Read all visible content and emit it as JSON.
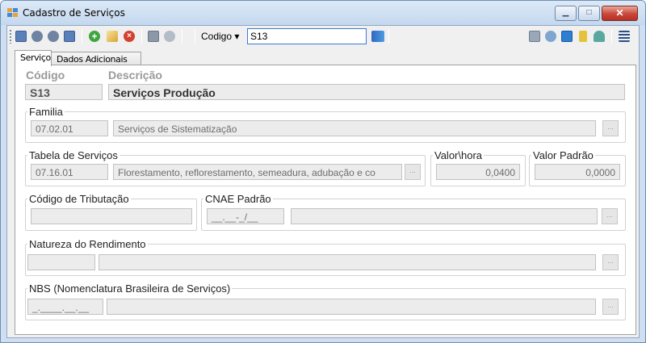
{
  "window": {
    "title": "Cadastro de Serviços",
    "minimize_label": "▁",
    "maximize_label": "□",
    "close_label": "✕"
  },
  "toolbar": {
    "codigo_label": "Codigo ▾",
    "codigo_value": "S13",
    "icons_left": [
      "first-record-icon",
      "previous-record-icon",
      "next-record-icon",
      "last-record-icon",
      "add-icon",
      "edit-icon",
      "delete-icon",
      "save-icon",
      "undo-icon"
    ],
    "icons_right": [
      "print-icon",
      "filter-icon",
      "refresh-icon",
      "export-icon",
      "user-icon",
      "menu-icon"
    ]
  },
  "tabs": [
    {
      "label": "Serviço",
      "active": true
    },
    {
      "label": "Dados Adicionais",
      "active": false
    }
  ],
  "form": {
    "codigo_header": "Código",
    "descricao_header": "Descrição",
    "codigo_value": "S13",
    "descricao_value": "Serviços Produção",
    "familia": {
      "label": "Familia",
      "code": "07.02.01",
      "description": "Serviços de Sistematização",
      "button": "..."
    },
    "tabela": {
      "label": "Tabela de Serviços",
      "code": "07.16.01",
      "description": "Florestamento, reflorestamento, semeadura, adubação e co",
      "button": "..."
    },
    "valor_hora": {
      "label": "Valor\\hora",
      "value": "0,0400"
    },
    "valor_padrao": {
      "label": "Valor Padrão",
      "value": "0,0000"
    },
    "tributacao": {
      "label": "Código de Tributação",
      "value": ""
    },
    "cnae": {
      "label": "CNAE Padrão",
      "mask": "__.__-_/__",
      "description": "",
      "button": "..."
    },
    "natureza": {
      "label": "Natureza do Rendimento",
      "code": "",
      "description": "",
      "button": "..."
    },
    "nbs": {
      "label": "NBS (Nomenclatura Brasileira de Serviços)",
      "mask": "_.____.__.__",
      "description": "",
      "button": "..."
    }
  },
  "colors": {
    "title_bar": "#c4d8ee",
    "close_button": "#c9463a",
    "field_bg": "#ececec",
    "header_text": "#9a9a9a"
  }
}
